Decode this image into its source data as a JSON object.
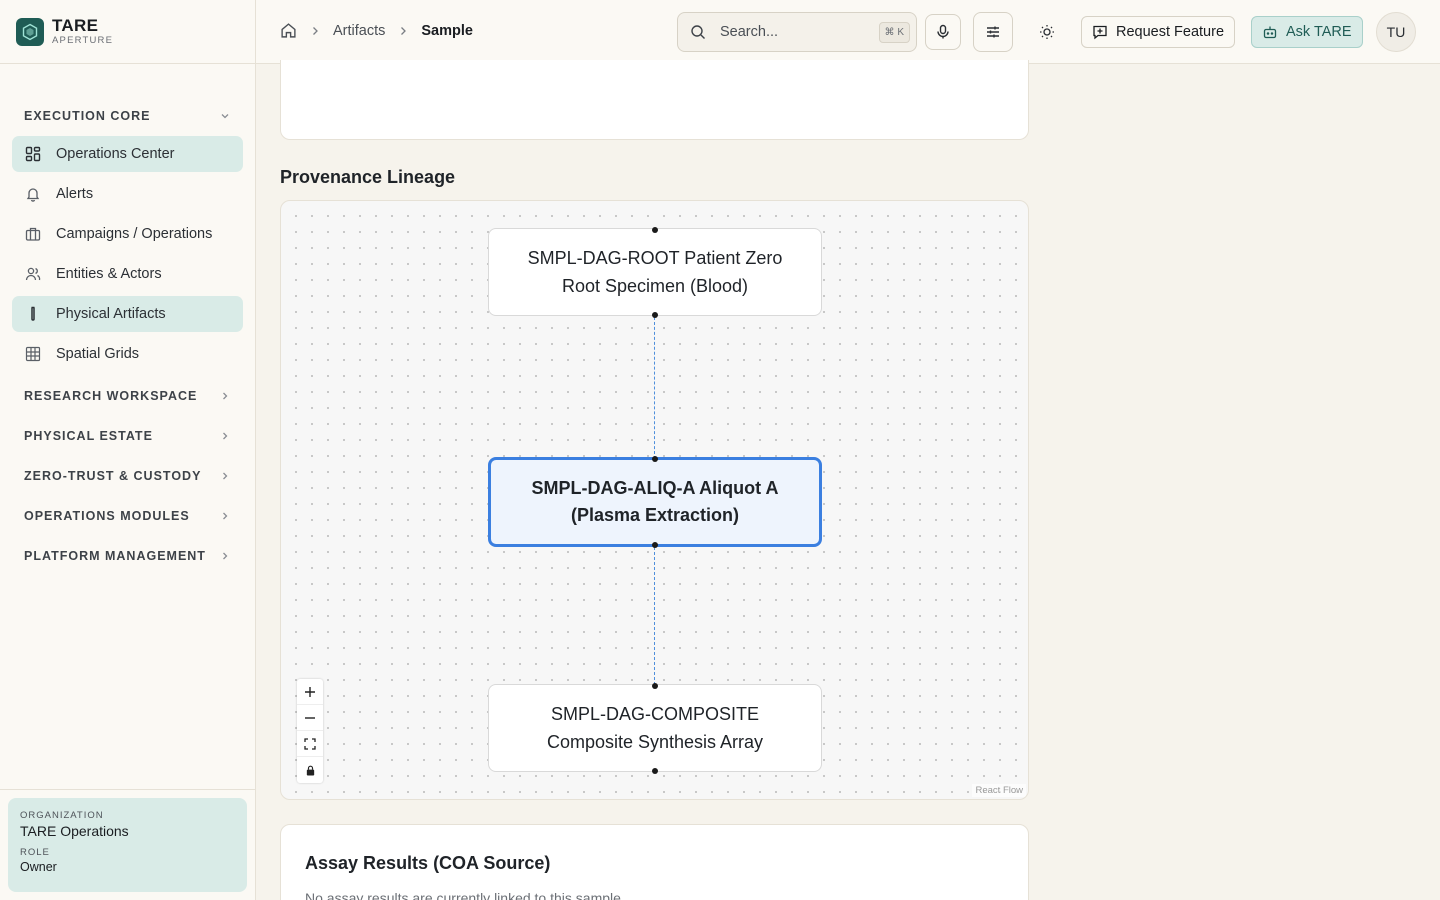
{
  "brand": {
    "title": "TARE",
    "subtitle": "APERTURE"
  },
  "sidebar": {
    "sections": [
      {
        "label": "EXECUTION CORE",
        "expanded": true
      },
      {
        "label": "RESEARCH WORKSPACE",
        "expanded": false
      },
      {
        "label": "PHYSICAL ESTATE",
        "expanded": false
      },
      {
        "label": "ZERO-TRUST & CUSTODY",
        "expanded": false
      },
      {
        "label": "OPERATIONS MODULES",
        "expanded": false
      },
      {
        "label": "PLATFORM MANAGEMENT",
        "expanded": false
      }
    ],
    "items": [
      {
        "label": "Operations Center",
        "icon": "dashboard-icon",
        "active": true
      },
      {
        "label": "Alerts",
        "icon": "bell-icon",
        "active": false
      },
      {
        "label": "Campaigns / Operations",
        "icon": "briefcase-icon",
        "active": false
      },
      {
        "label": "Entities & Actors",
        "icon": "users-icon",
        "active": false
      },
      {
        "label": "Physical Artifacts",
        "icon": "test-tube-icon",
        "active": true
      },
      {
        "label": "Spatial Grids",
        "icon": "grid-icon",
        "active": false
      }
    ],
    "org": {
      "org_label": "ORGANIZATION",
      "org_name": "TARE Operations",
      "role_label": "ROLE",
      "role": "Owner"
    }
  },
  "topbar": {
    "breadcrumb": [
      "Artifacts",
      "Sample"
    ],
    "search_placeholder": "Search...",
    "search_shortcut": "⌘ K",
    "request_feature": "Request Feature",
    "ask": "Ask TARE",
    "avatar": "TU"
  },
  "lineage": {
    "title": "Provenance Lineage",
    "nodes": [
      {
        "text": "SMPL-DAG-ROOT Patient Zero Root Specimen (Blood)",
        "selected": false
      },
      {
        "text": "SMPL-DAG-ALIQ-A Aliquot A (Plasma Extraction)",
        "selected": true
      },
      {
        "text": "SMPL-DAG-COMPOSITE Composite Synthesis Array",
        "selected": false
      }
    ],
    "attribution": "React Flow",
    "edge_color": "#4f8fdc"
  },
  "assay": {
    "title": "Assay Results (COA Source)",
    "empty_text": "No assay results are currently linked to this sample."
  },
  "colors": {
    "accent": "#1f5c55",
    "active_bg": "#d9ebe7",
    "selected_node": "#3b7fe0"
  }
}
